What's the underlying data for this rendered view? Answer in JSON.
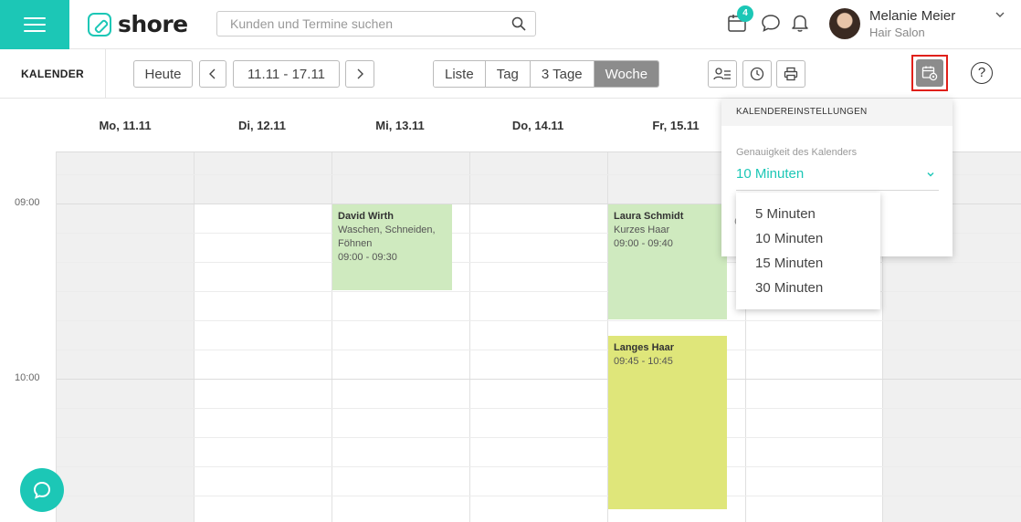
{
  "app": {
    "name": "shore"
  },
  "search": {
    "placeholder": "Kunden und Termine suchen"
  },
  "notifications": {
    "calendar_badge": "4"
  },
  "user": {
    "name": "Melanie Meier",
    "salon": "Hair Salon"
  },
  "toolbar": {
    "title": "KALENDER",
    "today_label": "Heute",
    "date_range": "11.11 - 17.11",
    "views": [
      "Liste",
      "Tag",
      "3 Tage",
      "Woche"
    ],
    "active_view": "Woche",
    "help_label": "?"
  },
  "calendar": {
    "days": [
      "Mo, 11.11",
      "Di, 12.11",
      "Mi, 13.11",
      "Do, 14.11",
      "Fr, 15.11"
    ],
    "time_labels": [
      "09:00",
      "10:00"
    ],
    "appointments": [
      {
        "name": "David Wirth",
        "service": "Waschen, Schneiden, Föhnen",
        "time": "09:00 - 09:30",
        "color": "#cfeabf"
      },
      {
        "name": "Laura Schmidt",
        "service": "Kurzes Haar",
        "time": "09:00 - 09:40",
        "color": "#cfeabf"
      },
      {
        "name": "Langes Haar",
        "service": "",
        "time": "09:45 - 10:45",
        "color": "#dfe67a"
      }
    ]
  },
  "settings_popup": {
    "title": "KALENDEREINSTELLUNGEN",
    "accuracy_label": "Genauigkeit des Kalenders",
    "accuracy_value": "10 Minuten",
    "options": [
      "5 Minuten",
      "10 Minuten",
      "15 Minuten",
      "30 Minuten"
    ]
  },
  "colors": {
    "accent": "#1cc7b6",
    "highlight": "#e0201a",
    "active_view_bg": "#8c8c8c"
  }
}
